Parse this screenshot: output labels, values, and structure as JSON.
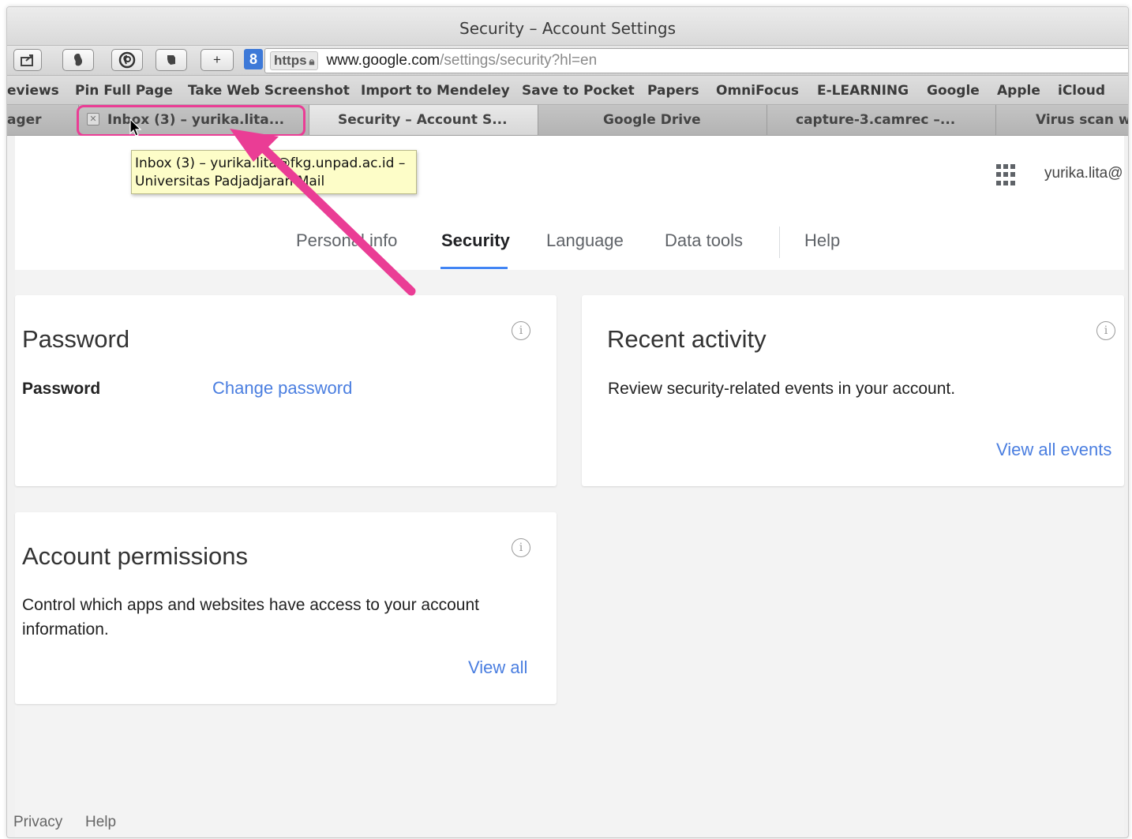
{
  "window": {
    "title": "Security – Account Settings"
  },
  "toolbar": {
    "add_label": "+",
    "extension_badge": "8",
    "url": {
      "scheme": "https",
      "host": "www.google.com",
      "path": "/settings/security?hl=en"
    }
  },
  "bookmarks": [
    "eviews",
    "Pin Full Page",
    "Take Web Screenshot",
    "Import to Mendeley",
    "Save to Pocket",
    "Papers",
    "OmniFocus",
    "E-LEARNING",
    "Google",
    "Apple",
    "iCloud"
  ],
  "tabs": [
    "ager",
    "Inbox (3) – yurika.lita...",
    "Security – Account S...",
    "Google Drive",
    "capture-3.camrec –...",
    "Virus scan w"
  ],
  "tooltip": {
    "line1": "Inbox (3) – yurika.lita@fkg.unpad.ac.id –",
    "line2": "Universitas Padjadjaran Mail"
  },
  "header": {
    "user_email": "yurika.lita@"
  },
  "nav": {
    "items": [
      "Personal info",
      "Security",
      "Language",
      "Data tools",
      "Help"
    ],
    "active": "Security"
  },
  "cards": {
    "password": {
      "title": "Password",
      "label": "Password",
      "link": "Change password"
    },
    "recent_activity": {
      "title": "Recent activity",
      "text": "Review security-related events in your account.",
      "link": "View all events"
    },
    "account_permissions": {
      "title": "Account permissions",
      "text": "Control which apps and websites have access to your account information.",
      "link": "View all"
    }
  },
  "footer": {
    "privacy": "Privacy",
    "help": "Help"
  },
  "colors": {
    "accent": "#4285f4",
    "link": "#4a7ee0",
    "annotation": "#ea3d95",
    "tooltip_bg": "#fdfdc8"
  }
}
